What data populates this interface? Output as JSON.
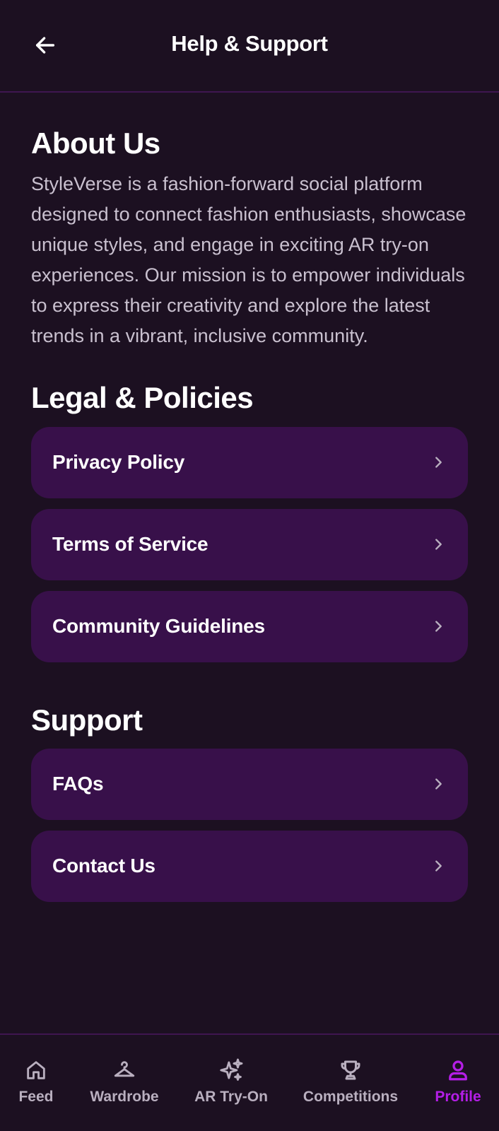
{
  "header": {
    "title": "Help & Support",
    "back_icon": "arrow-left-icon"
  },
  "about": {
    "title": "About Us",
    "text": "StyleVerse is a fashion-forward social platform designed to connect fashion enthusiasts, showcase unique styles, and engage in exciting AR try-on experiences. Our mission is to empower individuals to express their creativity and explore the latest trends in a vibrant, inclusive community."
  },
  "legal": {
    "title": "Legal & Policies",
    "items": [
      {
        "label": "Privacy Policy"
      },
      {
        "label": "Terms of Service"
      },
      {
        "label": "Community Guidelines"
      }
    ]
  },
  "support": {
    "title": "Support",
    "items": [
      {
        "label": "FAQs"
      },
      {
        "label": "Contact Us"
      }
    ]
  },
  "nav": {
    "items": [
      {
        "label": "Feed",
        "icon": "home-icon",
        "active": false
      },
      {
        "label": "Wardrobe",
        "icon": "hanger-icon",
        "active": false
      },
      {
        "label": "AR Try-On",
        "icon": "sparkles-icon",
        "active": false
      },
      {
        "label": "Competitions",
        "icon": "trophy-icon",
        "active": false
      },
      {
        "label": "Profile",
        "icon": "user-icon",
        "active": true
      }
    ]
  },
  "colors": {
    "background": "#1c1021",
    "card": "#38104a",
    "divider": "#3f1650",
    "accent": "#b41ee6",
    "muted_text": "#c9c0cf"
  }
}
